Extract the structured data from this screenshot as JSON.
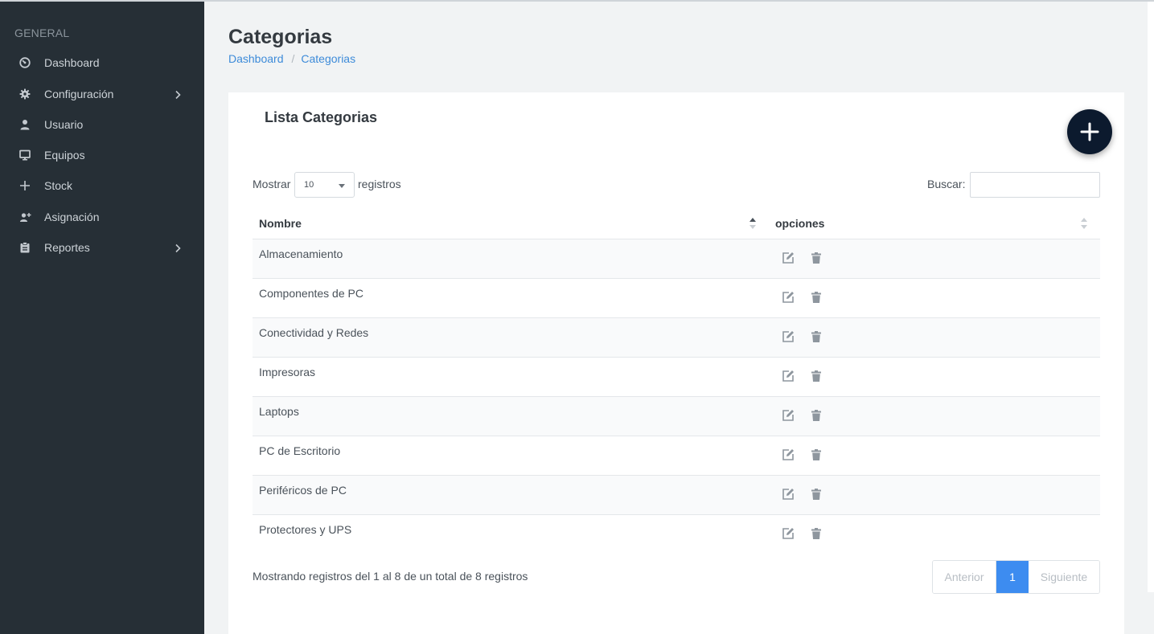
{
  "sidebar": {
    "heading": "GENERAL",
    "items": [
      {
        "label": "Dashboard",
        "icon": "dashboard-gauge-icon",
        "has_children": false
      },
      {
        "label": "Configuración",
        "icon": "gear-icon",
        "has_children": true
      },
      {
        "label": "Usuario",
        "icon": "user-icon",
        "has_children": false
      },
      {
        "label": "Equipos",
        "icon": "monitor-icon",
        "has_children": false
      },
      {
        "label": "Stock",
        "icon": "plus-icon",
        "has_children": false
      },
      {
        "label": "Asignación",
        "icon": "user-plus-icon",
        "has_children": false
      },
      {
        "label": "Reportes",
        "icon": "clipboard-icon",
        "has_children": true
      }
    ]
  },
  "page": {
    "title": "Categorias",
    "breadcrumb": {
      "home": "Dashboard",
      "separator": "/",
      "current": "Categorias"
    }
  },
  "card": {
    "title": "Lista Categorias",
    "add_button_icon": "plus-icon"
  },
  "table_controls": {
    "length_prefix": "Mostrar",
    "length_value": "10",
    "length_suffix": "registros",
    "search_label": "Buscar:",
    "search_value": ""
  },
  "table": {
    "columns": [
      "Nombre",
      "opciones"
    ],
    "rows": [
      {
        "name": "Almacenamiento"
      },
      {
        "name": "Componentes de PC"
      },
      {
        "name": "Conectividad y Redes"
      },
      {
        "name": "Impresoras"
      },
      {
        "name": "Laptops"
      },
      {
        "name": "PC de Escritorio"
      },
      {
        "name": "Periféricos de PC"
      },
      {
        "name": "Protectores y UPS"
      }
    ],
    "row_actions": [
      "edit-icon",
      "trash-icon"
    ]
  },
  "footer": {
    "info": "Mostrando registros del 1 al 8 de un total de 8 registros",
    "pager": {
      "prev": "Anterior",
      "current": "1",
      "next": "Siguiente"
    }
  },
  "colors": {
    "sidebar_bg": "#262f36",
    "page_bg": "#f1f3f4",
    "accent": "#3d8cf0",
    "fab_bg": "#0c1a2e",
    "link": "#3d8bd9"
  }
}
